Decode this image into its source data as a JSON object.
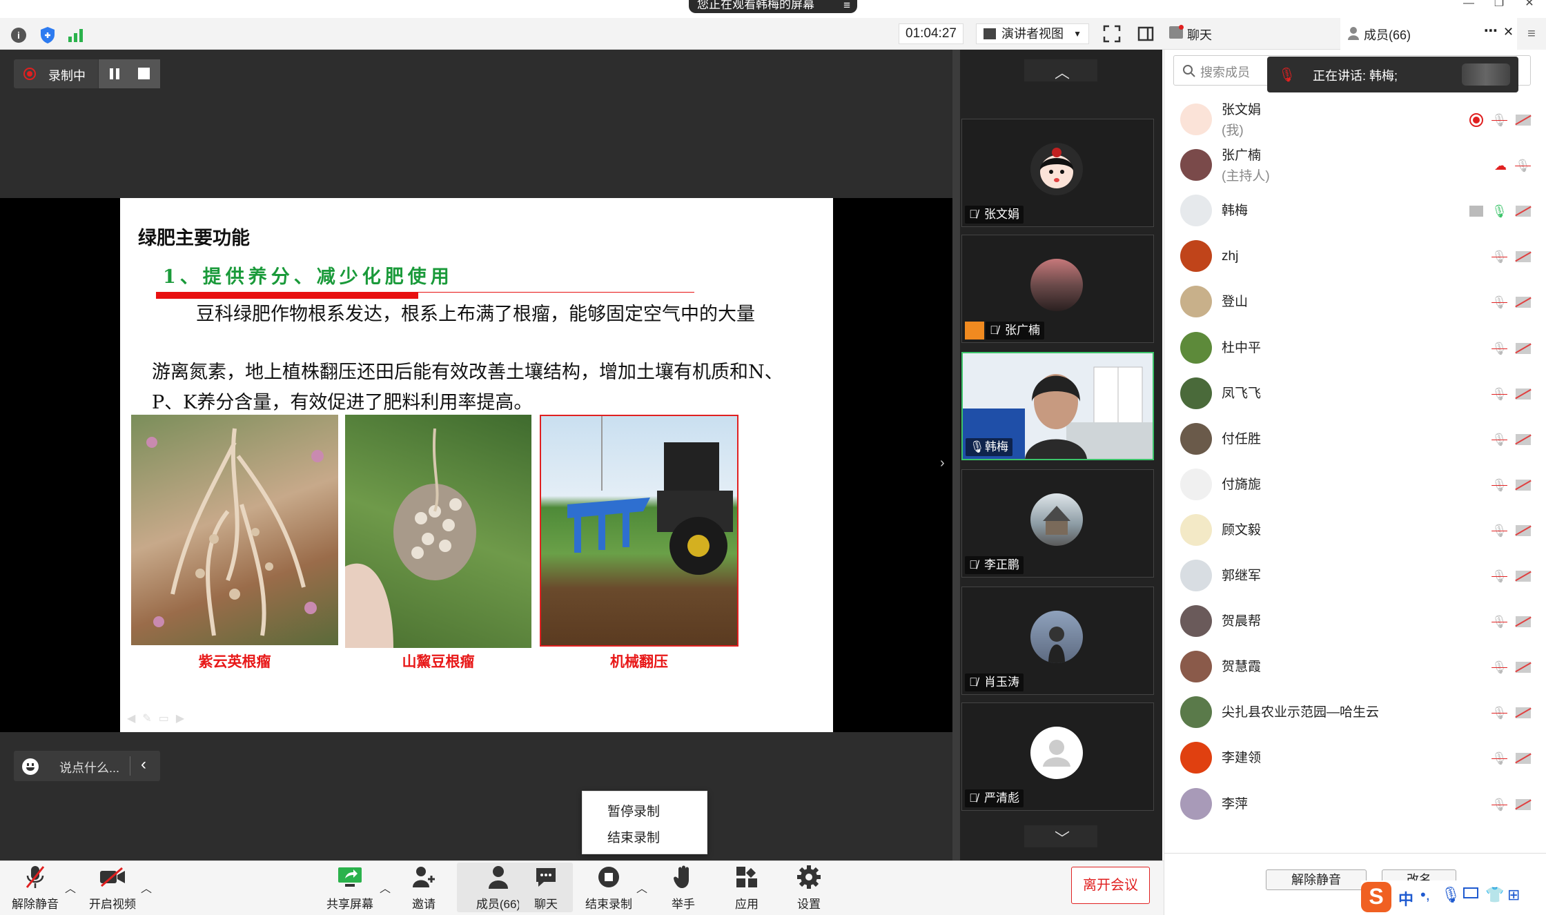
{
  "banner": {
    "text": "您正在观看韩梅的屏幕"
  },
  "toolbar": {
    "timer": "01:04:27",
    "view_mode": "演讲者视图"
  },
  "tabs": {
    "chat": "聊天",
    "members": "成员(66)"
  },
  "recording": {
    "status": "录制中"
  },
  "slide": {
    "title": "绿肥主要功能",
    "subtitle": "1、提供养分、减少化肥使用",
    "para1": "豆科绿肥作物根系发达，根系上布满了根瘤，能够固定空气中的大量",
    "para2": "游离氮素，地上植株翻压还田后能有效改善土壤结构，增加土壤有机质和N、",
    "para3": "P、K养分含量，有效促进了肥料利用率提高。",
    "captions": [
      "紫云英根瘤",
      "山黧豆根瘤",
      "机械翻压"
    ]
  },
  "chat_input": {
    "placeholder": "说点什么..."
  },
  "record_menu": {
    "pause": "暂停录制",
    "stop": "结束录制"
  },
  "video_tiles": [
    {
      "name": "张文娟"
    },
    {
      "name": "张广楠"
    },
    {
      "name": "韩梅"
    },
    {
      "name": "李正鹏"
    },
    {
      "name": "肖玉涛"
    },
    {
      "name": "严清彪"
    }
  ],
  "search": {
    "placeholder": "搜索成员"
  },
  "speaking": {
    "text": "正在讲话: 韩梅;"
  },
  "participants": [
    {
      "name": "张文娟",
      "sub": "(我)"
    },
    {
      "name": "张广楠",
      "sub": "(主持人)"
    },
    {
      "name": "韩梅",
      "sub": ""
    },
    {
      "name": "zhj",
      "sub": ""
    },
    {
      "name": "登山",
      "sub": ""
    },
    {
      "name": "杜中平",
      "sub": ""
    },
    {
      "name": "凤飞飞",
      "sub": ""
    },
    {
      "name": "付任胜",
      "sub": ""
    },
    {
      "name": "付旖旎",
      "sub": ""
    },
    {
      "name": "顾文毅",
      "sub": ""
    },
    {
      "name": "郭继军",
      "sub": ""
    },
    {
      "name": "贺晨帮",
      "sub": ""
    },
    {
      "name": "贺慧霞",
      "sub": ""
    },
    {
      "name": "尖扎县农业示范园—哈生云",
      "sub": ""
    },
    {
      "name": "李建领",
      "sub": ""
    },
    {
      "name": "李萍",
      "sub": ""
    }
  ],
  "panel_buttons": {
    "unmute_all": "解除静音",
    "rename": "改名"
  },
  "bottom": {
    "unmute": "解除静音",
    "video": "开启视频",
    "share": "共享屏幕",
    "invite": "邀请",
    "members": "成员(66)",
    "chat": "聊天",
    "stop_record": "结束录制",
    "raise_hand": "举手",
    "apps": "应用",
    "settings": "设置",
    "leave": "离开会议"
  },
  "ime": {
    "lang": "中"
  },
  "colors": {
    "accent_red": "#e02020",
    "green_title": "#1a9a3a",
    "panel_bg": "#ffffff",
    "main_bg": "#2d2d2d"
  }
}
